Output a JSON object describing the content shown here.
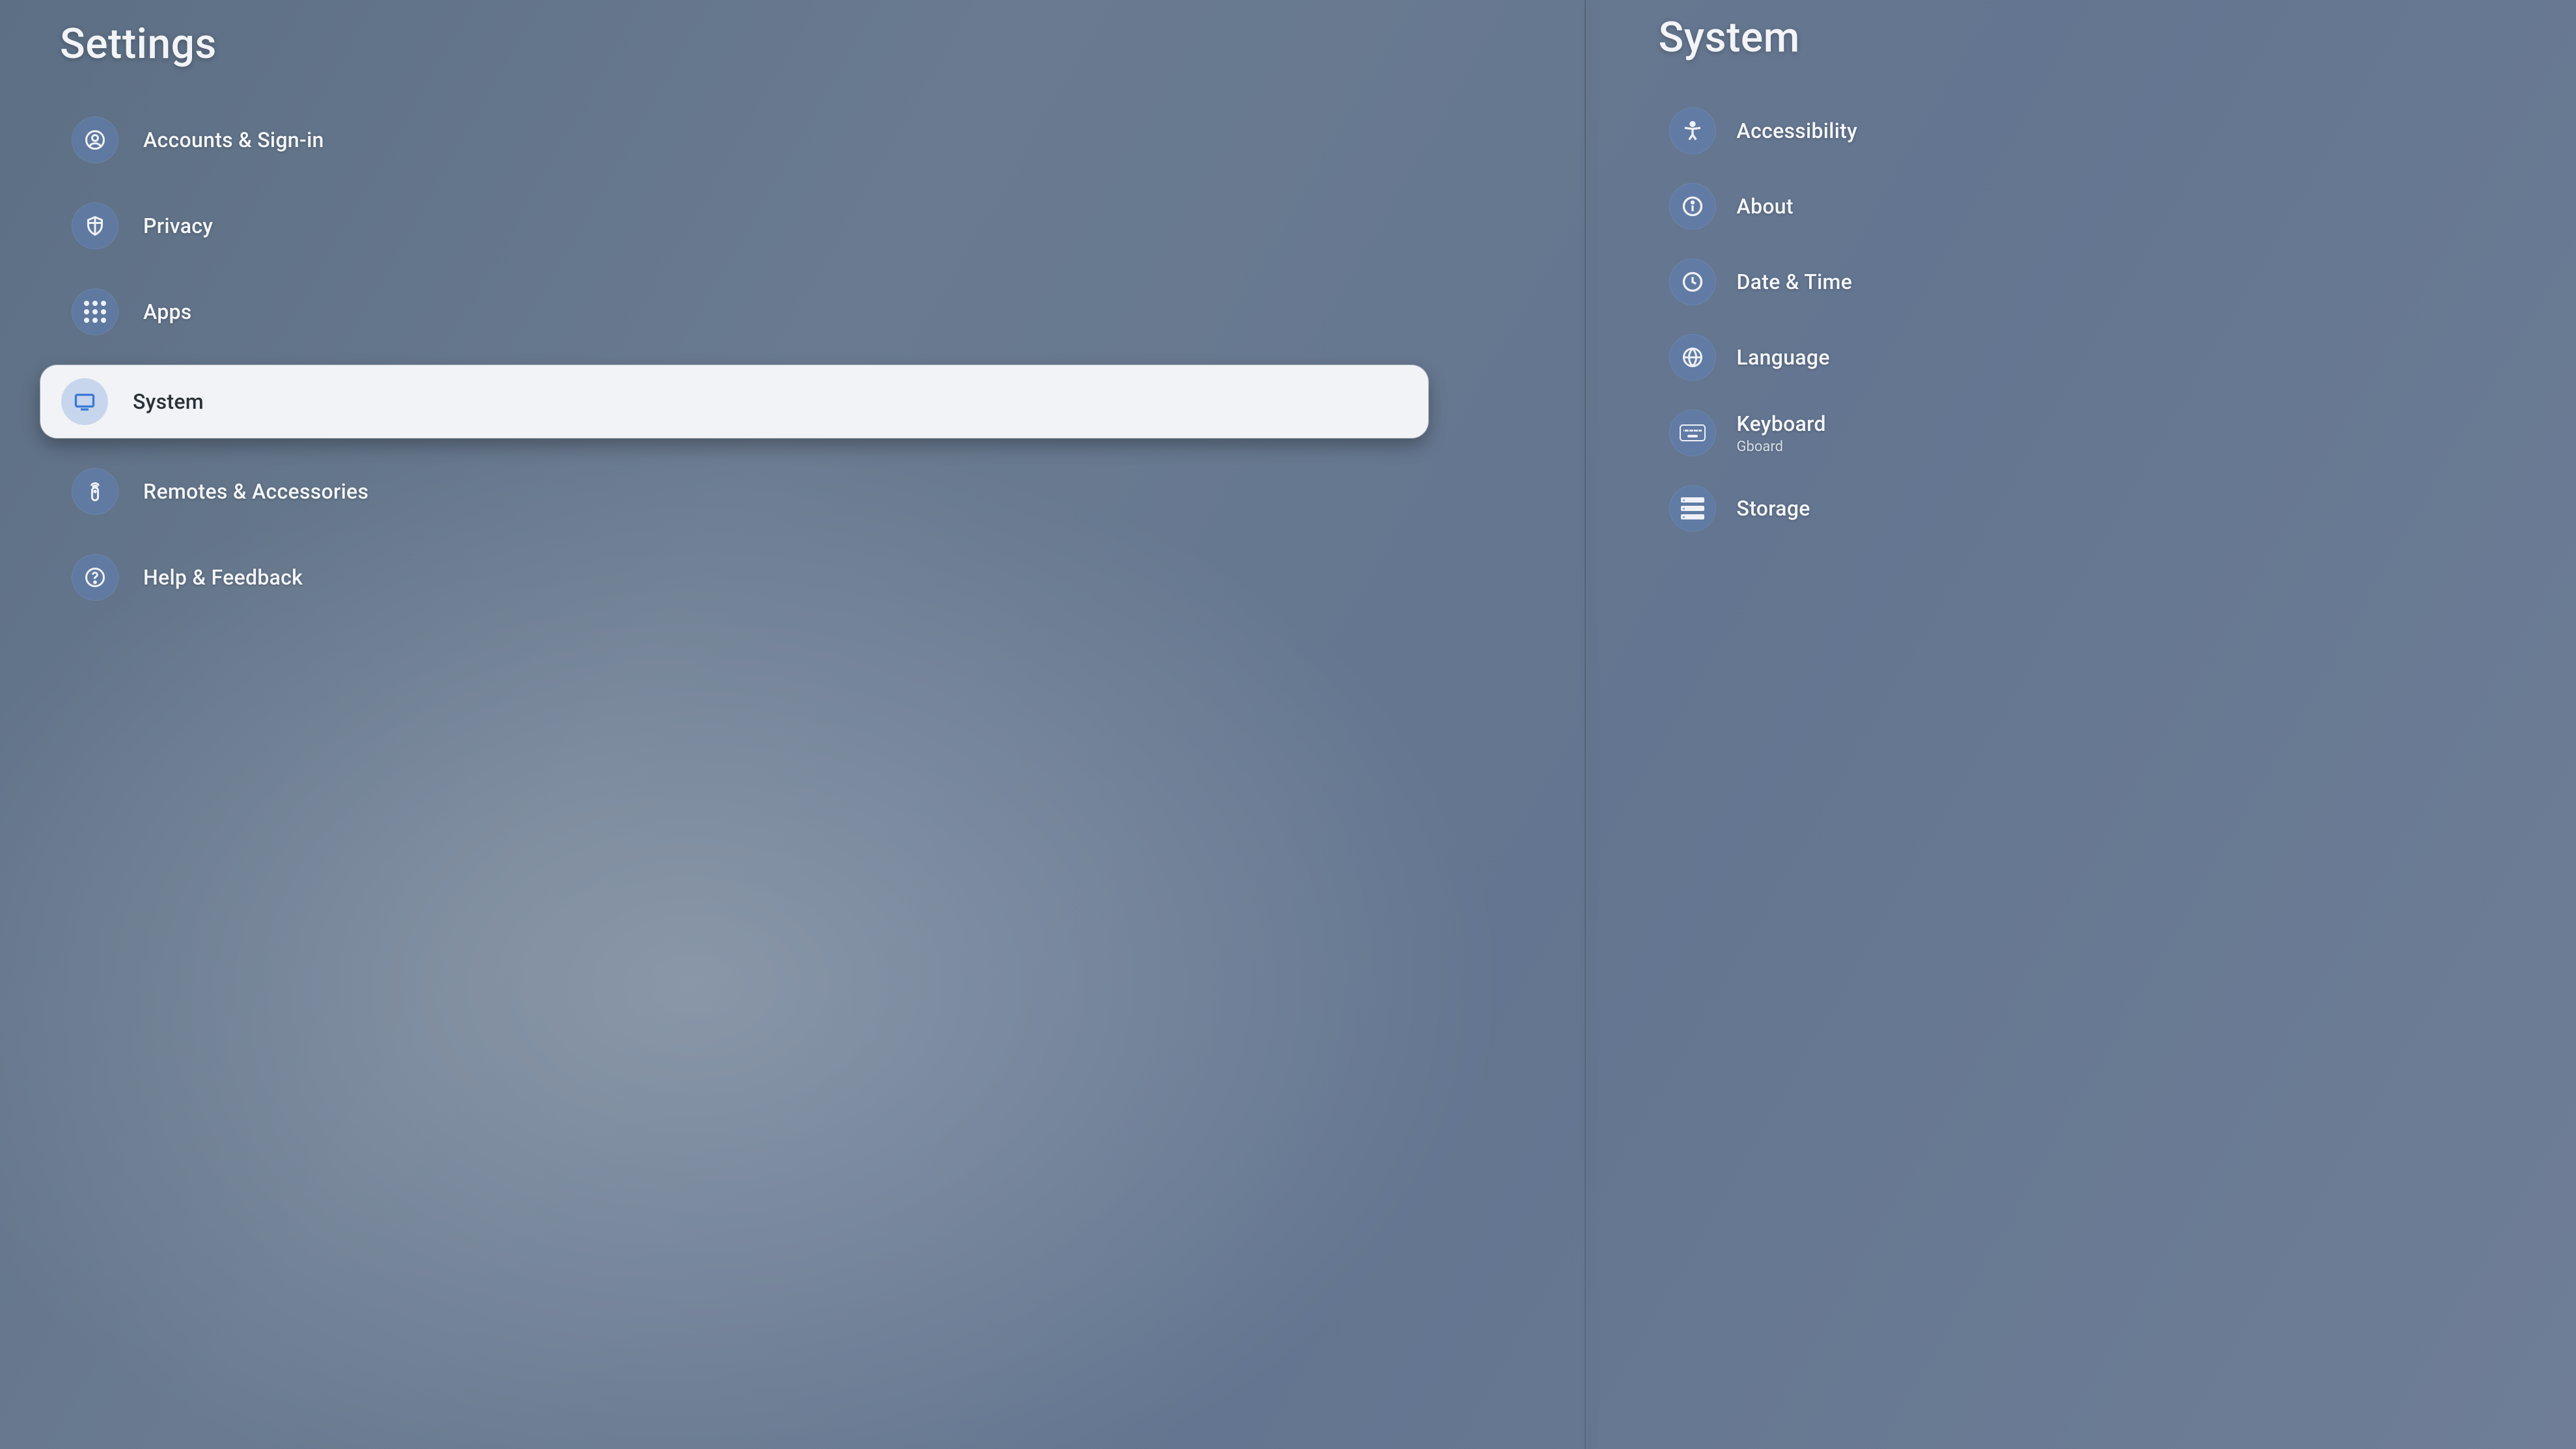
{
  "left": {
    "title": "Settings",
    "items": [
      {
        "id": "accounts",
        "label": "Accounts & Sign-in",
        "icon": "account"
      },
      {
        "id": "privacy",
        "label": "Privacy",
        "icon": "shield"
      },
      {
        "id": "apps",
        "label": "Apps",
        "icon": "apps"
      },
      {
        "id": "system",
        "label": "System",
        "icon": "tv",
        "focused": true
      },
      {
        "id": "remotes",
        "label": "Remotes & Accessories",
        "icon": "remote"
      },
      {
        "id": "help",
        "label": "Help & Feedback",
        "icon": "help"
      }
    ]
  },
  "right": {
    "title": "System",
    "items": [
      {
        "id": "accessibility",
        "label": "Accessibility",
        "icon": "accessibility"
      },
      {
        "id": "about",
        "label": "About",
        "icon": "info"
      },
      {
        "id": "datetime",
        "label": "Date & Time",
        "icon": "clock"
      },
      {
        "id": "language",
        "label": "Language",
        "icon": "globe"
      },
      {
        "id": "keyboard",
        "label": "Keyboard",
        "icon": "keyboard",
        "sublabel": "Gboard"
      },
      {
        "id": "storage",
        "label": "Storage",
        "icon": "storage"
      }
    ]
  }
}
